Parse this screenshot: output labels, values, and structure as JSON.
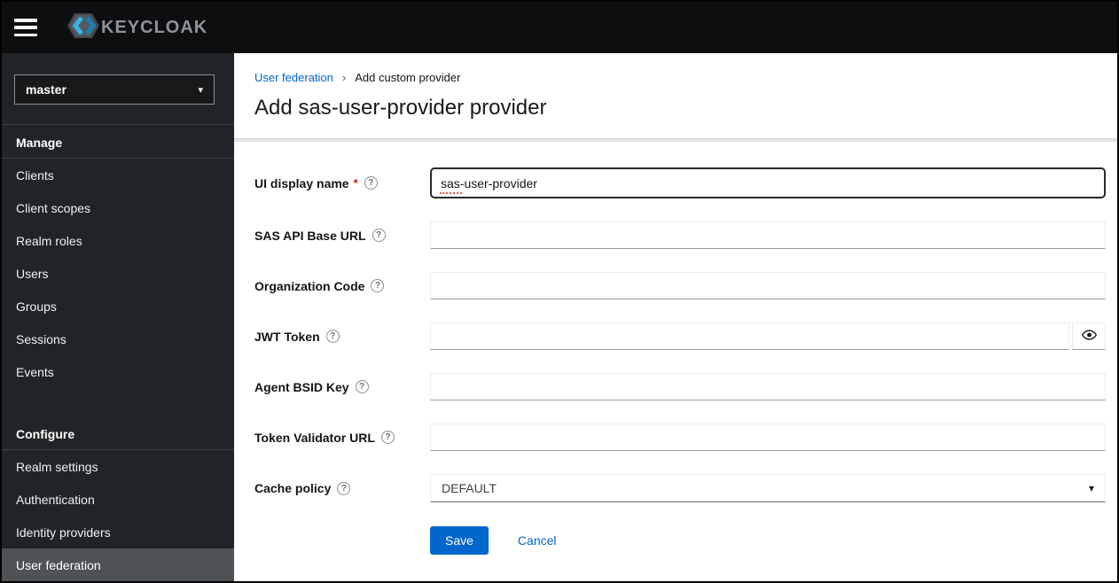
{
  "header": {
    "brand_text": "KEYCLOAK"
  },
  "sidebar": {
    "realm_selector": {
      "value": "master"
    },
    "sections": [
      {
        "title": "Manage",
        "items": [
          {
            "label": "Clients"
          },
          {
            "label": "Client scopes"
          },
          {
            "label": "Realm roles"
          },
          {
            "label": "Users"
          },
          {
            "label": "Groups"
          },
          {
            "label": "Sessions"
          },
          {
            "label": "Events"
          }
        ]
      },
      {
        "title": "Configure",
        "items": [
          {
            "label": "Realm settings"
          },
          {
            "label": "Authentication"
          },
          {
            "label": "Identity providers"
          },
          {
            "label": "User federation",
            "selected": true
          }
        ]
      }
    ]
  },
  "breadcrumb": {
    "separator": "›",
    "items": [
      {
        "label": "User federation",
        "link": true
      },
      {
        "label": "Add custom provider",
        "link": false
      }
    ]
  },
  "page_title": "Add sas-user-provider provider",
  "form": {
    "required_marker": "*",
    "fields": [
      {
        "label": "UI display name",
        "required": true,
        "value": "sas-user-provider",
        "type": "text",
        "focused": true
      },
      {
        "label": "SAS API Base URL",
        "value": "",
        "type": "text"
      },
      {
        "label": "Organization Code",
        "value": "",
        "type": "text"
      },
      {
        "label": "JWT Token",
        "value": "",
        "type": "password",
        "toggle": "eye-icon"
      },
      {
        "label": "Agent BSID Key",
        "value": "",
        "type": "text"
      },
      {
        "label": "Token Validator URL",
        "value": "",
        "type": "text"
      },
      {
        "label": "Cache policy",
        "value": "DEFAULT",
        "type": "select"
      }
    ],
    "actions": {
      "save": "Save",
      "cancel": "Cancel"
    }
  },
  "icons": {
    "help": "?",
    "select_caret": "▾",
    "realm_caret": "▾",
    "breadcrumb_separator": "›"
  },
  "colors": {
    "accent": "#0066cc",
    "header_bg": "#0d0e10",
    "sidebar_bg": "#212427",
    "sidebar_selected_bg": "#4f5255",
    "required_red": "#c9190b",
    "brand_blue": "#35b4e5"
  }
}
